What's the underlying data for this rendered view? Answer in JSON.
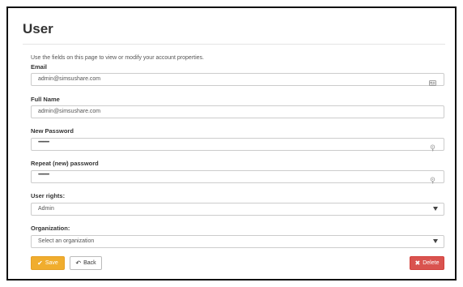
{
  "page": {
    "title": "User",
    "intro": "Use the fields on this page to view or modify your account properties."
  },
  "form": {
    "email": {
      "label": "Email",
      "value": "admin@simsushare.com",
      "icon": "contact-card-icon"
    },
    "full_name": {
      "label": "Full Name",
      "value": "admin@simsushare.com"
    },
    "new_password": {
      "label": "New Password",
      "value": "••••••••••••",
      "icon": "key-icon"
    },
    "repeat_password": {
      "label": "Repeat (new) password",
      "value": "••••••••••••",
      "icon": "key-icon"
    },
    "user_rights": {
      "label": "User rights:",
      "selected": "Admin"
    },
    "organization": {
      "label": "Organization:",
      "placeholder": "Select an organization"
    }
  },
  "actions": {
    "save": {
      "label": "Save",
      "icon": "checkmark-icon",
      "color": "#f0ad2e"
    },
    "back": {
      "label": "Back",
      "icon": "reply-arrow-icon"
    },
    "delete": {
      "label": "Delete",
      "icon": "times-icon",
      "color": "#d9534f"
    }
  }
}
